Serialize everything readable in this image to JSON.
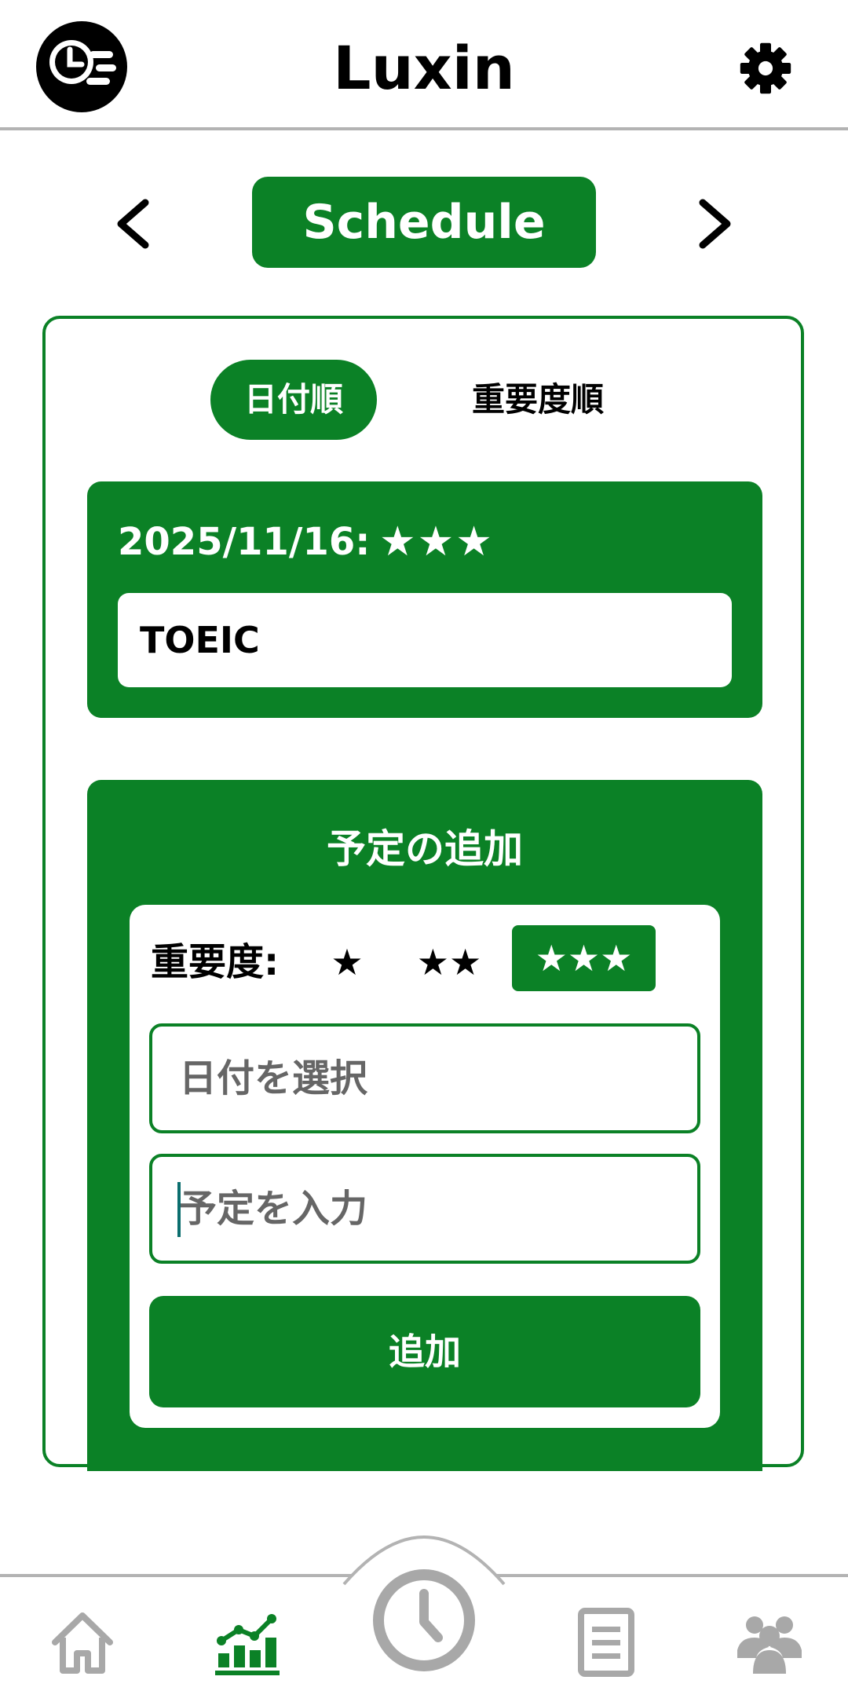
{
  "app": {
    "title": "Luxin"
  },
  "header": {
    "logo_icon": "clock-logo-icon",
    "settings_icon": "gear-icon"
  },
  "schedule_nav": {
    "label": "Schedule",
    "prev_icon": "chevron-left-icon",
    "next_icon": "chevron-right-icon"
  },
  "sort_tabs": [
    {
      "label": "日付順",
      "active": true
    },
    {
      "label": "重要度順",
      "active": false
    }
  ],
  "events": [
    {
      "date": "2025/11/16:",
      "stars": "★★★",
      "title": "TOEIC"
    }
  ],
  "add_form": {
    "title": "予定の追加",
    "importance_label": "重要度:",
    "importance_options": [
      "★",
      "★★",
      "★★★"
    ],
    "importance_selected": 3,
    "date_placeholder": "日付を選択",
    "plan_placeholder": "予定を入力",
    "submit_label": "追加"
  },
  "bottom_nav": {
    "items": [
      "home-icon",
      "stats-icon",
      "clock-icon",
      "notes-icon",
      "group-icon"
    ],
    "active": "stats-icon"
  },
  "colors": {
    "accent": "#0b8126",
    "inactive": "#a8a8a8",
    "divider": "#b3b3b3"
  }
}
